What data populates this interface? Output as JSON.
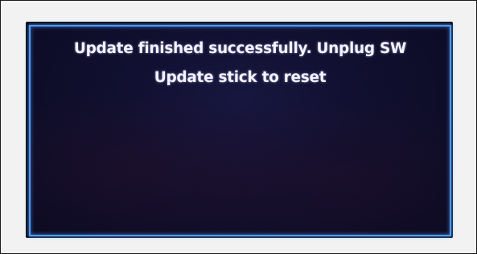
{
  "dialog": {
    "line1": "Update finished successfully. Unplug SW",
    "line2": "Update stick to reset"
  },
  "colors": {
    "screen_background": "#100f2e",
    "border_glow": "#4a9cff",
    "text": "#f4f3ff"
  }
}
